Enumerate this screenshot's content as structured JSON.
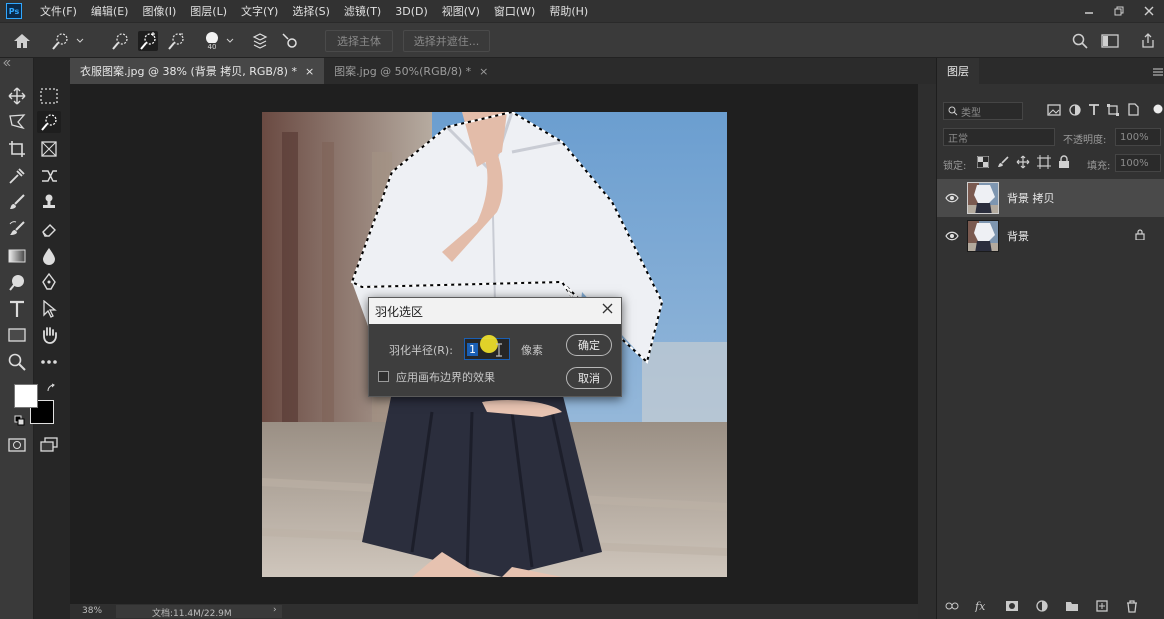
{
  "app": {
    "logo": "Ps"
  },
  "menu": [
    "文件(F)",
    "编辑(E)",
    "图像(I)",
    "图层(L)",
    "文字(Y)",
    "选择(S)",
    "滤镜(T)",
    "3D(D)",
    "视图(V)",
    "窗口(W)",
    "帮助(H)"
  ],
  "options": {
    "brush_size": "40",
    "select_subject": "选择主体",
    "select_and_mask": "选择并遮住..."
  },
  "tabs": [
    {
      "label": "衣服图案.jpg @ 38% (背景 拷贝, RGB/8) *",
      "close": "×"
    },
    {
      "label": "图案.jpg @ 50%(RGB/8) *",
      "close": "×"
    }
  ],
  "status": {
    "zoom": "38%",
    "doc": "文档:11.4M/22.9M",
    "arrow": "›"
  },
  "panel": {
    "title": "图层",
    "filter_placeholder": "类型",
    "blend_mode": "正常",
    "opacity_label": "不透明度:",
    "opacity_value": "100%",
    "lock_label": "锁定:",
    "fill_label": "填充:",
    "fill_value": "100%",
    "layers": [
      {
        "name": "背景 拷贝",
        "selected": true,
        "locked": false
      },
      {
        "name": "背景",
        "selected": false,
        "locked": true
      }
    ]
  },
  "dialog": {
    "title": "羽化选区",
    "radius_label": "羽化半径(R):",
    "radius_value": "1",
    "unit": "像素",
    "ok": "确定",
    "cancel": "取消",
    "checkbox_label": "应用画布边界的效果"
  }
}
